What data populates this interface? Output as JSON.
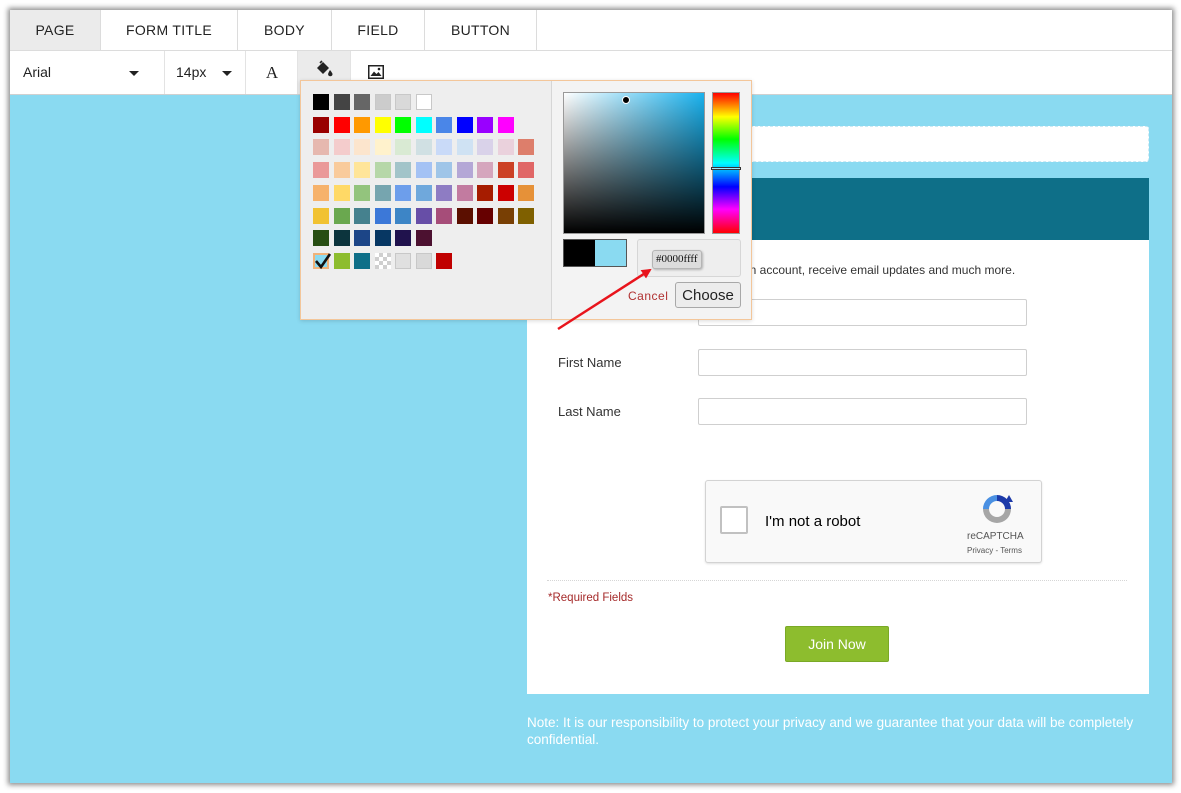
{
  "tabs": [
    {
      "label": "PAGE",
      "active": true
    },
    {
      "label": "FORM TITLE",
      "active": false
    },
    {
      "label": "BODY",
      "active": false
    },
    {
      "label": "FIELD",
      "active": false
    },
    {
      "label": "BUTTON",
      "active": false
    }
  ],
  "toolbar": {
    "font_family": "Arial",
    "font_size": "14px",
    "text_color_icon": "font-color-icon",
    "fill_icon": "paint-bucket-icon",
    "image_icon": "image-icon"
  },
  "color_picker": {
    "palette_rows": [
      [
        "#000000",
        "#444444",
        "#666666",
        "#cccccc",
        "#d9d9d9",
        "#ffffff"
      ],
      [
        "#990000",
        "#ff0000",
        "#ff9900",
        "#ffff00",
        "#00ff00",
        "#00ffff",
        "#4a86e8",
        "#0000ff",
        "#9900ff",
        "#ff00ff"
      ],
      [
        "#e6b8af",
        "#f4cccc",
        "#fce5cd",
        "#fff2cc",
        "#d9ead3",
        "#d0e0e3",
        "#c9daf8",
        "#cfe2f3",
        "#d9d2e9",
        "#ead1dc",
        "#dd7e6b"
      ],
      [
        "#ea9999",
        "#f9cb9c",
        "#ffe599",
        "#b6d7a8",
        "#a2c4c9",
        "#a4c2f4",
        "#9fc5e8",
        "#b4a7d6",
        "#d5a6bd",
        "#cc4125",
        "#e06666"
      ],
      [
        "#f6b26b",
        "#ffd966",
        "#93c47d",
        "#76a5af",
        "#6d9eeb",
        "#6fa8dc",
        "#8e7cc3",
        "#c27ba0",
        "#a61c00",
        "#cc0000",
        "#e69138"
      ],
      [
        "#f1c232",
        "#6aa84f",
        "#45818e",
        "#3c78d8",
        "#3d85c6",
        "#674ea7",
        "#a64d79",
        "#5b0f00",
        "#660000",
        "#783f04",
        "#7f6000"
      ],
      [
        "#274e13",
        "#0c343d",
        "#1c4587",
        "#073763",
        "#20124d",
        "#4c1130"
      ],
      [
        "#8adaf1",
        "#8dbd2e",
        "#0e6f88",
        "transparent",
        "#e0e0e0",
        "#d9d9d9",
        "#c00000"
      ]
    ],
    "selected_color": "#8adaf1",
    "hue_color": "#1ab2ee",
    "hex_value": "#0000ffff",
    "cancel_label": "Cancel",
    "choose_label": "Choose"
  },
  "form": {
    "header_color": "#0e6f88",
    "intro_text": "an account, receive email updates and much more.",
    "fields": [
      {
        "label": ""
      },
      {
        "label": "First Name"
      },
      {
        "label": "Last Name"
      }
    ],
    "captcha": {
      "label": "I'm not a robot",
      "brand": "reCAPTCHA",
      "links": "Privacy - Terms"
    },
    "required_note": "*Required Fields",
    "submit_label": "Join Now",
    "privacy_note": "Note: It is our responsibility to protect your privacy and we guarantee that your data will be completely confidential."
  },
  "colors": {
    "page_background": "#8adaf1",
    "submit_button": "#8dbd2e",
    "annotation_arrow": "#e8141c"
  }
}
